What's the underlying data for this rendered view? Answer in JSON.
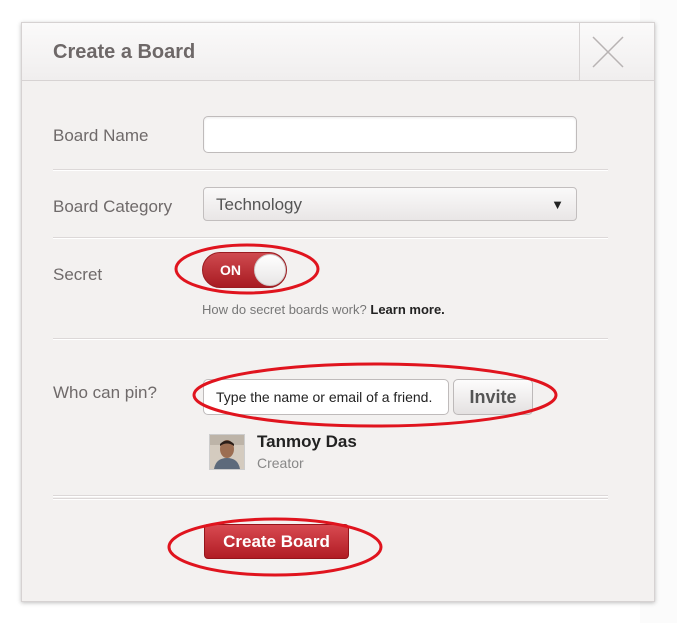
{
  "dialog": {
    "title": "Create a Board",
    "close_icon": "close-x-icon"
  },
  "form": {
    "board_name": {
      "label": "Board Name",
      "value": "",
      "placeholder": ""
    },
    "board_category": {
      "label": "Board Category",
      "selected": "Technology",
      "arrow": "▼"
    },
    "secret": {
      "label": "Secret",
      "toggle_state": "ON",
      "help_text": "How do secret boards work?",
      "help_link": "Learn more."
    },
    "who_can_pin": {
      "label": "Who can pin?",
      "input_placeholder": "Type the name or email of a friend.",
      "invite_label": "Invite"
    },
    "creator": {
      "name": "Tanmoy Das",
      "role": "Creator"
    }
  },
  "footer": {
    "create_label": "Create Board"
  },
  "colors": {
    "accent_red": "#b11c24",
    "annotation_red": "#e0141e"
  }
}
